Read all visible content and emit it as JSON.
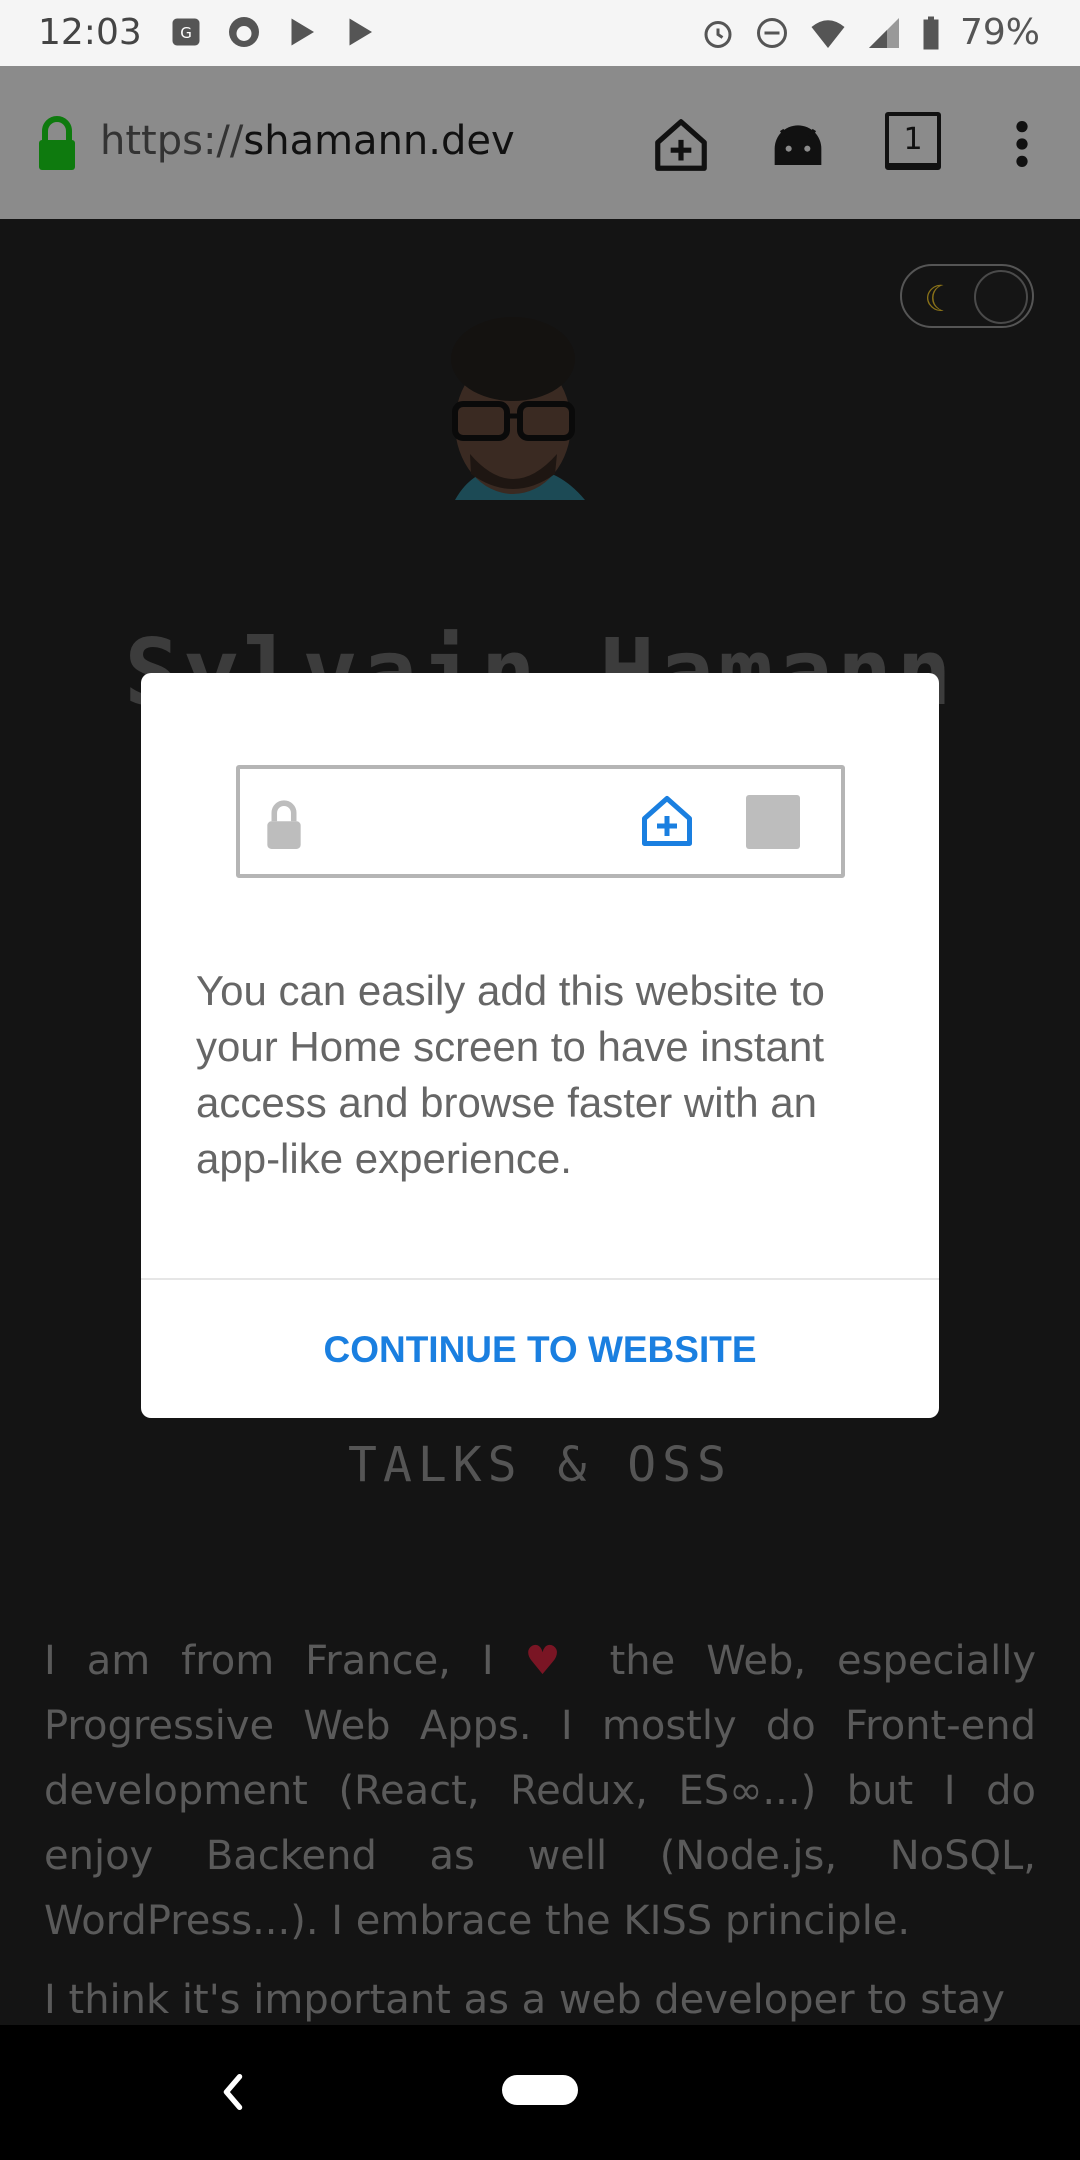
{
  "status_bar": {
    "time": "12:03",
    "battery_percent": "79%",
    "left_icons": [
      "maps-icon",
      "firefox-icon",
      "play-store-icon",
      "play-store-icon"
    ],
    "right_icons": [
      "alarm-icon",
      "do-not-disturb-icon",
      "wifi-icon",
      "signal-icon",
      "battery-icon"
    ]
  },
  "browser": {
    "url_scheme": "https://",
    "url_host": "shamann.dev",
    "tab_count": "1"
  },
  "page": {
    "name": "Sylvain Hamann",
    "section_heading": "TALKS & OSS",
    "bio_part1": "I am from France, I ",
    "bio_part2": " the Web, especially Progressive Web Apps. I mostly do Front-end development (React, Redux, ES∞...) but I do enjoy Backend as well (Node.js, NoSQL, WordPress...). I embrace the KISS principle.",
    "bio_line2": "I think it's important as a web developer to stay"
  },
  "modal": {
    "message": "You can easily add this website to your Home screen to have instant access and browse faster with an app-like experience.",
    "button_label": "CONTINUE TO WEBSITE"
  },
  "colors": {
    "accent": "#1a7fe0",
    "lock_green": "#1b8a1b",
    "overlay": "#141414"
  }
}
